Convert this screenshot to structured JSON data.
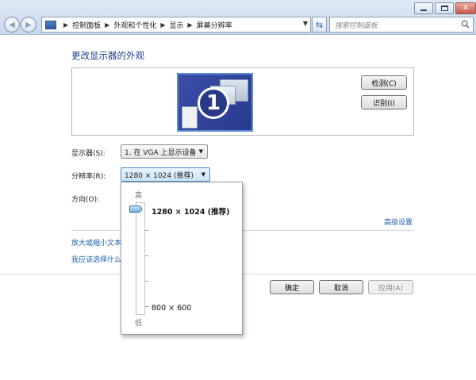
{
  "window": {
    "breadcrumbs": [
      "控制面板",
      "外观和个性化",
      "显示",
      "屏幕分辨率"
    ],
    "search_placeholder": "搜索控制面板"
  },
  "main": {
    "title": "更改显示器的外观",
    "monitor_number": "1",
    "detect_button": "检测(C)",
    "identify_button": "识别(I)",
    "display_label": "显示器(S):",
    "display_value": "1. 在 VGA 上显示设备",
    "resolution_label": "分辨率(R):",
    "resolution_value": "1280 × 1024 (推荐)",
    "orientation_label": "方向(O):",
    "advanced_link": "高级设置",
    "link_text_size": "放大或缩小文本",
    "link_which_setting": "我应该选择什么"
  },
  "footer": {
    "ok_button": "确定",
    "cancel_button": "取消",
    "apply_button": "应用(A)"
  },
  "resolution_popup": {
    "high_label": "高",
    "low_label": "低",
    "max_resolution": "1280 × 1024 (推荐)",
    "min_resolution": "800 × 600",
    "slider_position": 1.0
  }
}
